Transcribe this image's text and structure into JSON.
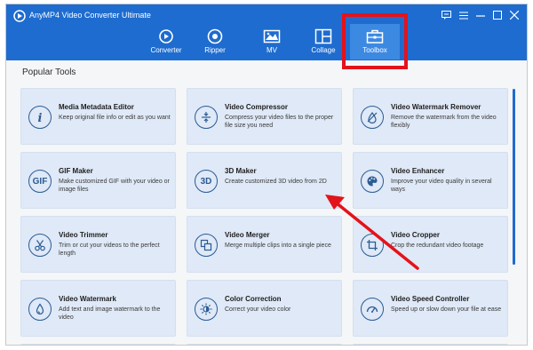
{
  "app": {
    "title": "AnyMP4 Video Converter Ultimate"
  },
  "nav": [
    {
      "label": "Converter",
      "icon": "converter-icon"
    },
    {
      "label": "Ripper",
      "icon": "ripper-icon"
    },
    {
      "label": "MV",
      "icon": "mv-icon"
    },
    {
      "label": "Collage",
      "icon": "collage-icon"
    },
    {
      "label": "Toolbox",
      "icon": "toolbox-icon",
      "active": true
    }
  ],
  "window_controls": [
    "feedback-icon",
    "menu-icon",
    "minimize-icon",
    "maximize-icon",
    "close-icon"
  ],
  "section": {
    "title": "Popular Tools"
  },
  "tools": [
    {
      "title": "Media Metadata Editor",
      "desc": "Keep original file info or edit as you want",
      "icon": "info-icon"
    },
    {
      "title": "Video Compressor",
      "desc": "Compress your video files to the proper file size you need",
      "icon": "compress-icon"
    },
    {
      "title": "Video Watermark Remover",
      "desc": "Remove the watermark from the video flexibly",
      "icon": "watermark-remove-icon"
    },
    {
      "title": "GIF Maker",
      "desc": "Make customized GIF with your video or image files",
      "icon": "gif-icon",
      "icon_text": "GIF"
    },
    {
      "title": "3D Maker",
      "desc": "Create customized 3D video from 2D",
      "icon": "3d-icon",
      "icon_text": "3D"
    },
    {
      "title": "Video Enhancer",
      "desc": "Improve your video quality in several ways",
      "icon": "palette-icon"
    },
    {
      "title": "Video Trimmer",
      "desc": "Trim or cut your videos to the perfect length",
      "icon": "scissors-icon"
    },
    {
      "title": "Video Merger",
      "desc": "Merge multiple clips into a single piece",
      "icon": "merge-icon"
    },
    {
      "title": "Video Cropper",
      "desc": "Crop the redundant video footage",
      "icon": "crop-icon"
    },
    {
      "title": "Video Watermark",
      "desc": "Add text and image watermark to the video",
      "icon": "droplet-icon"
    },
    {
      "title": "Color Correction",
      "desc": "Correct your video color",
      "icon": "sun-icon"
    },
    {
      "title": "Video Speed Controller",
      "desc": "Speed up or slow down your file at ease",
      "icon": "speedometer-icon"
    }
  ],
  "colors": {
    "header": "#1e6ccf",
    "active_tab": "#3c89e2",
    "card": "#dfe9f7",
    "annotation": "#e3131b"
  }
}
